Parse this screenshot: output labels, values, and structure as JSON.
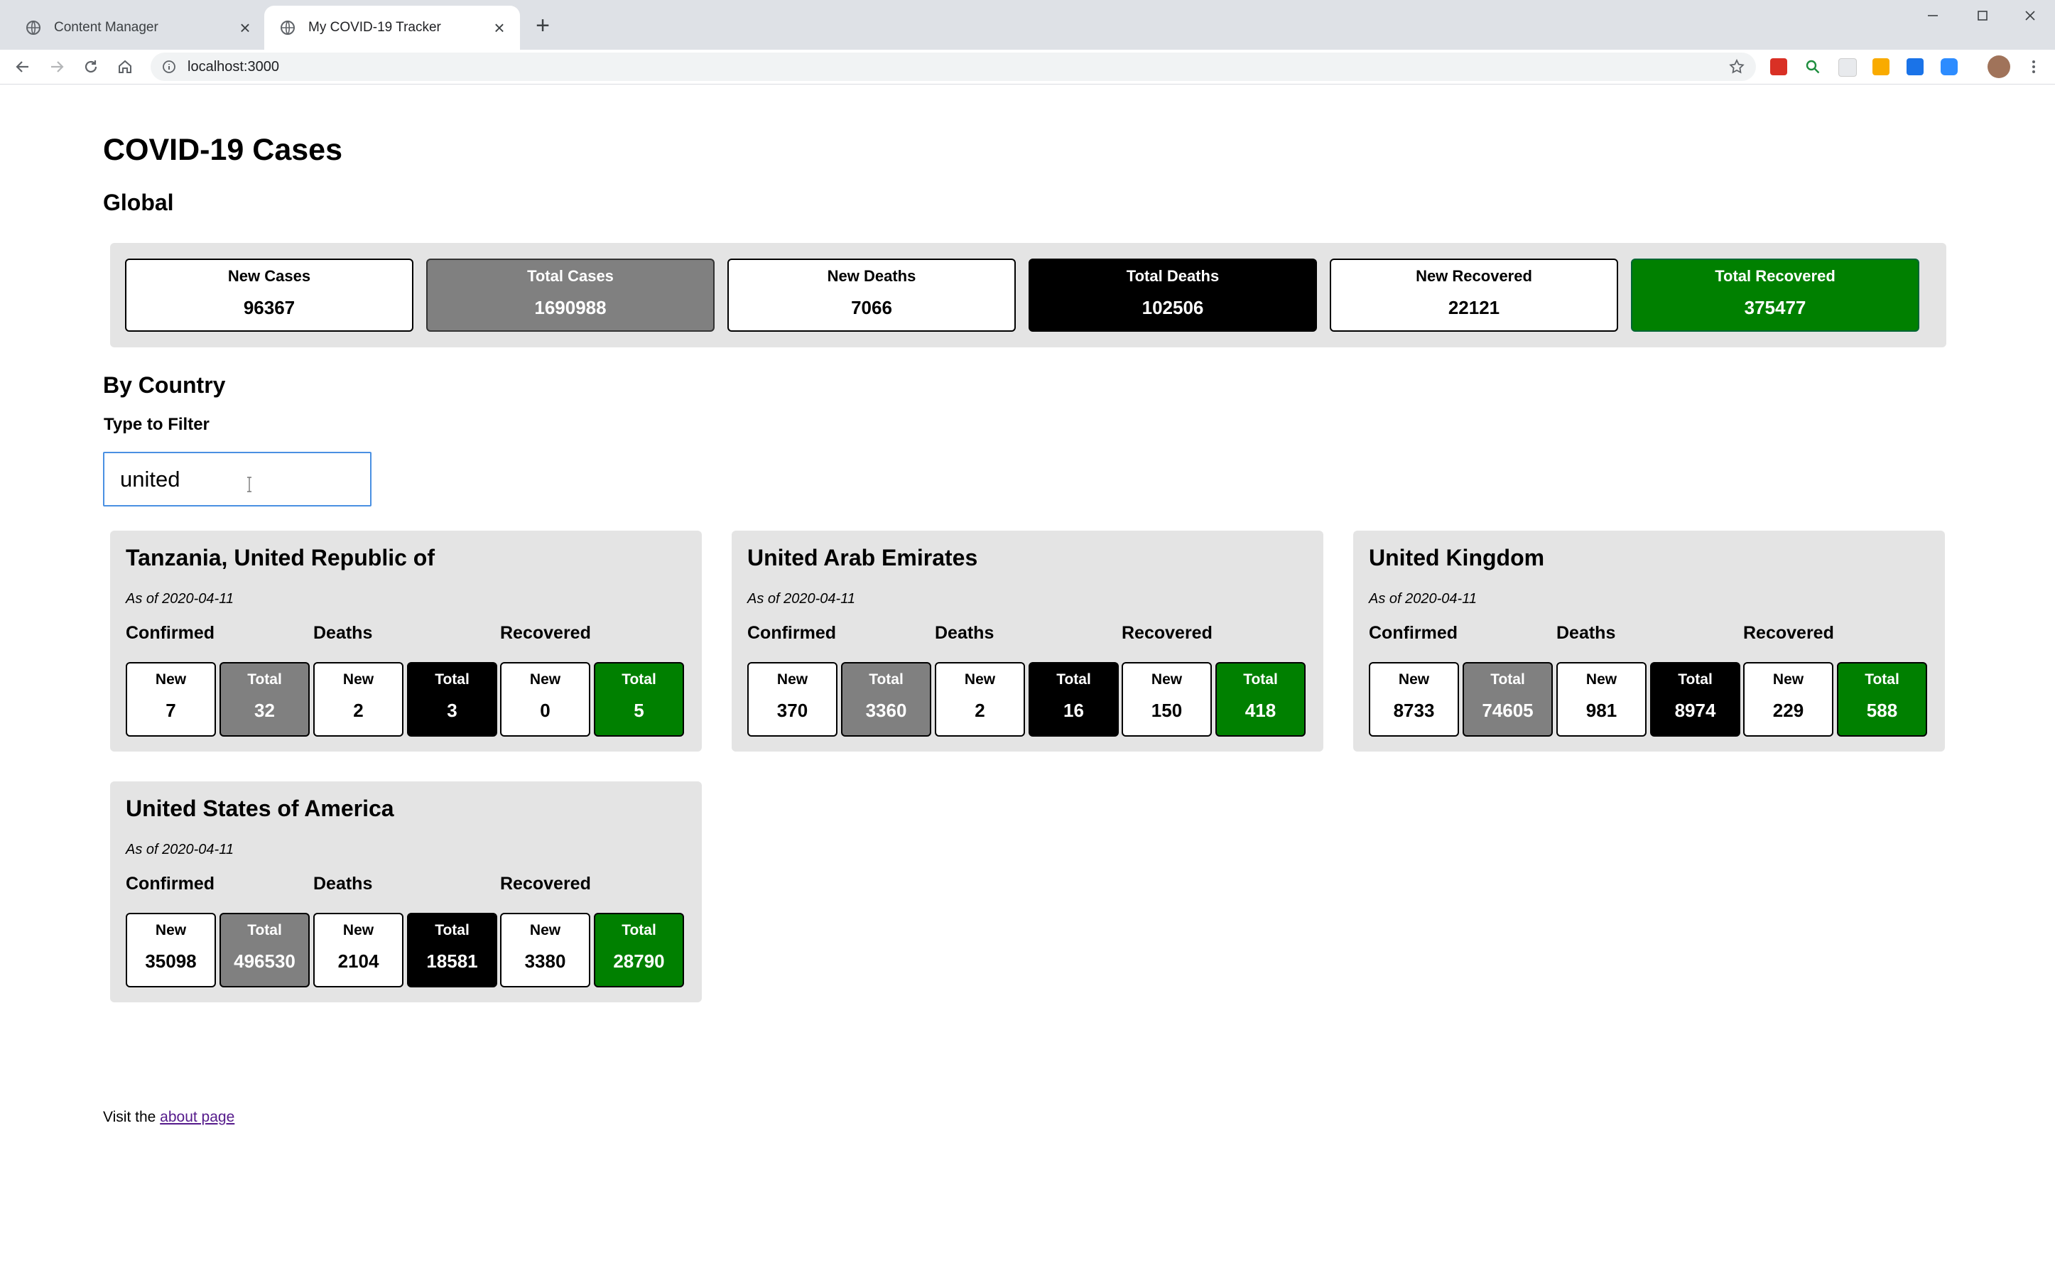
{
  "browser": {
    "tabs": [
      {
        "title": "Content Manager",
        "active": false
      },
      {
        "title": "My COVID-19 Tracker",
        "active": true
      }
    ],
    "url": "localhost:3000"
  },
  "page": {
    "title": "COVID-19 Cases",
    "global_heading": "Global",
    "global_stats": [
      {
        "label": "New Cases",
        "value": "96367",
        "style": "white"
      },
      {
        "label": "Total Cases",
        "value": "1690988",
        "style": "grey"
      },
      {
        "label": "New Deaths",
        "value": "7066",
        "style": "white"
      },
      {
        "label": "Total Deaths",
        "value": "102506",
        "style": "black"
      },
      {
        "label": "New Recovered",
        "value": "22121",
        "style": "white"
      },
      {
        "label": "Total Recovered",
        "value": "375477",
        "style": "green"
      }
    ],
    "by_country_heading": "By Country",
    "filter_label": "Type to Filter",
    "filter_value": "united",
    "group_labels": [
      "Confirmed",
      "Deaths",
      "Recovered"
    ],
    "stat_labels": {
      "new": "New",
      "total": "Total"
    },
    "countries": [
      {
        "name": "Tanzania, United Republic of",
        "as_of": "As of 2020-04-11",
        "values": [
          "7",
          "32",
          "2",
          "3",
          "0",
          "5"
        ]
      },
      {
        "name": "United Arab Emirates",
        "as_of": "As of 2020-04-11",
        "values": [
          "370",
          "3360",
          "2",
          "16",
          "150",
          "418"
        ]
      },
      {
        "name": "United Kingdom",
        "as_of": "As of 2020-04-11",
        "values": [
          "8733",
          "74605",
          "981",
          "8974",
          "229",
          "588"
        ]
      },
      {
        "name": "United States of America",
        "as_of": "As of 2020-04-11",
        "values": [
          "35098",
          "496530",
          "2104",
          "18581",
          "3380",
          "28790"
        ]
      }
    ],
    "footer_prefix": "Visit the",
    "footer_link": "about page"
  },
  "colors": {
    "grey": "#808080",
    "black": "#000000",
    "green": "#008000",
    "panel": "#e4e4e4"
  }
}
